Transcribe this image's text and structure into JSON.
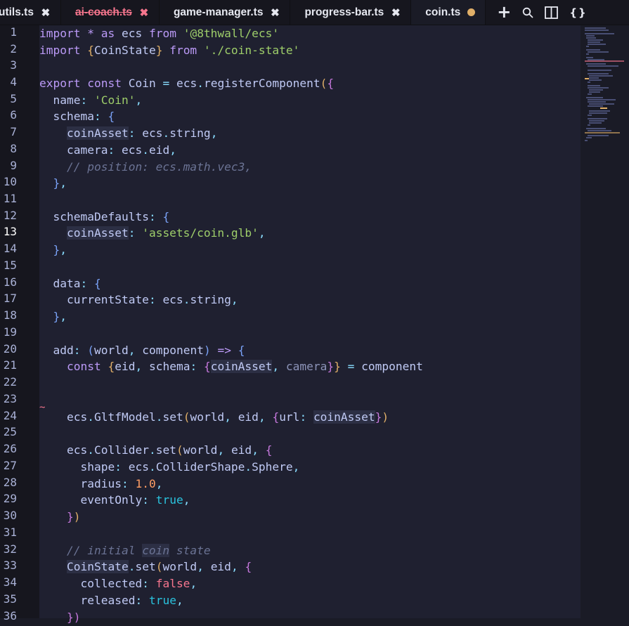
{
  "tabs": [
    {
      "label": "utils.ts",
      "state": "close"
    },
    {
      "label": "ai-coach.ts",
      "state": "error"
    },
    {
      "label": "game-manager.ts",
      "state": "close"
    },
    {
      "label": "progress-bar.ts",
      "state": "close"
    },
    {
      "label": "coin.ts",
      "state": "dirty"
    }
  ],
  "actions": {
    "new_file_icon": "plus-icon",
    "search_icon": "search-icon",
    "split_icon": "split-editor-icon",
    "braces_label": "{}"
  },
  "editor": {
    "current_line": 13,
    "line_numbers": [
      "1",
      "2",
      "3",
      "4",
      "5",
      "6",
      "7",
      "8",
      "9",
      "10",
      "11",
      "12",
      "13",
      "14",
      "15",
      "16",
      "17",
      "18",
      "19",
      "20",
      "21",
      "22",
      "23",
      "24",
      "25",
      "26",
      "27",
      "28",
      "29",
      "30",
      "31",
      "32",
      "33",
      "34",
      "35",
      "36"
    ],
    "lines": {
      "l1": {
        "import": "import",
        "star": " * ",
        "as": "as",
        "ns": " ecs ",
        "from": "from",
        "module": " '@8thwall/ecs'"
      },
      "l2": {
        "import": "import",
        "open": " {",
        "name": "CoinState",
        "close": "}",
        "from": " from",
        "module": " './coin-state'"
      },
      "l4": {
        "export": "export",
        "const": " const",
        "name": " Coin",
        "eq": " = ",
        "obj": "ecs",
        "dot": ".",
        "fn": "registerComponent",
        "paren": "(",
        "brace": "{"
      },
      "l5": {
        "key": "name",
        "colon": ": ",
        "val": "'Coin'",
        "comma": ","
      },
      "l6": {
        "key": "schema",
        "colon": ": ",
        "brace": "{"
      },
      "l7": {
        "key": "coinAsset",
        "colon": ": ",
        "obj": "ecs",
        "dot": ".",
        "prop": "string",
        "comma": ","
      },
      "l8": {
        "key": "camera",
        "colon": ": ",
        "obj": "ecs",
        "dot": ".",
        "prop": "eid",
        "comma": ","
      },
      "l9": {
        "comment": "// position: ecs.math.vec3,"
      },
      "l10": {
        "close": "}",
        "comma": ","
      },
      "l12": {
        "key": "schemaDefaults",
        "colon": ": ",
        "brace": "{"
      },
      "l13": {
        "key": "coinAsset",
        "colon": ": ",
        "val": "'assets/coin.glb'",
        "comma": ","
      },
      "l14": {
        "close": "}",
        "comma": ","
      },
      "l16": {
        "key": "data",
        "colon": ": ",
        "brace": "{"
      },
      "l17": {
        "key": "currentState",
        "colon": ": ",
        "obj": "ecs",
        "dot": ".",
        "prop": "string",
        "comma": ","
      },
      "l18": {
        "close": "}",
        "comma": ","
      },
      "l20": {
        "key": "add",
        "colon": ": ",
        "open": "(",
        "p1": "world",
        "sep": ", ",
        "p2": "component",
        "close": ")",
        "arrow": " => ",
        "brace": "{"
      },
      "l21": {
        "const": "const ",
        "o1": "{",
        "eid": "eid",
        "sep": ", ",
        "schema": "schema",
        "colon": ": ",
        "o2": "{",
        "coinAsset": "coinAsset",
        "sep2": ", ",
        "camera": "camera",
        "c2": "}",
        "c1": "}",
        "eq": " = ",
        "component": "component"
      },
      "l24": {
        "obj": "ecs",
        "dot": ".",
        "cls": "GltfModel",
        "dot2": ".",
        "fn": "set",
        "open": "(",
        "a1": "world",
        "sep": ", ",
        "a2": "eid",
        "sep2": ", ",
        "ob": "{",
        "key": "url",
        "colon": ": ",
        "val": "coinAsset",
        "cb": "}",
        "close": ")"
      },
      "l26": {
        "obj": "ecs",
        "dot": ".",
        "cls": "Collider",
        "dot2": ".",
        "fn": "set",
        "open": "(",
        "a1": "world",
        "sep": ", ",
        "a2": "eid",
        "sep2": ", ",
        "ob": "{"
      },
      "l27": {
        "key": "shape",
        "colon": ": ",
        "obj": "ecs",
        "dot": ".",
        "cls": "ColliderShape",
        "dot2": ".",
        "val": "Sphere",
        "comma": ","
      },
      "l28": {
        "key": "radius",
        "colon": ": ",
        "val": "1.0",
        "comma": ","
      },
      "l29": {
        "key": "eventOnly",
        "colon": ": ",
        "val": "true",
        "comma": ","
      },
      "l30": {
        "cb": "}",
        "close": ")"
      },
      "l32": {
        "c1": "// initial ",
        "c2": "coin",
        "c3": " state"
      },
      "l33": {
        "cls": "CoinState",
        "dot": ".",
        "fn": "set",
        "open": "(",
        "a1": "world",
        "sep": ", ",
        "a2": "eid",
        "sep2": ", ",
        "ob": "{"
      },
      "l34": {
        "key": "collected",
        "colon": ": ",
        "val": "false",
        "comma": ","
      },
      "l35": {
        "key": "released",
        "colon": ": ",
        "val": "true",
        "comma": ","
      },
      "l36": {
        "cb": "})"
      }
    },
    "error_marker": "~"
  }
}
